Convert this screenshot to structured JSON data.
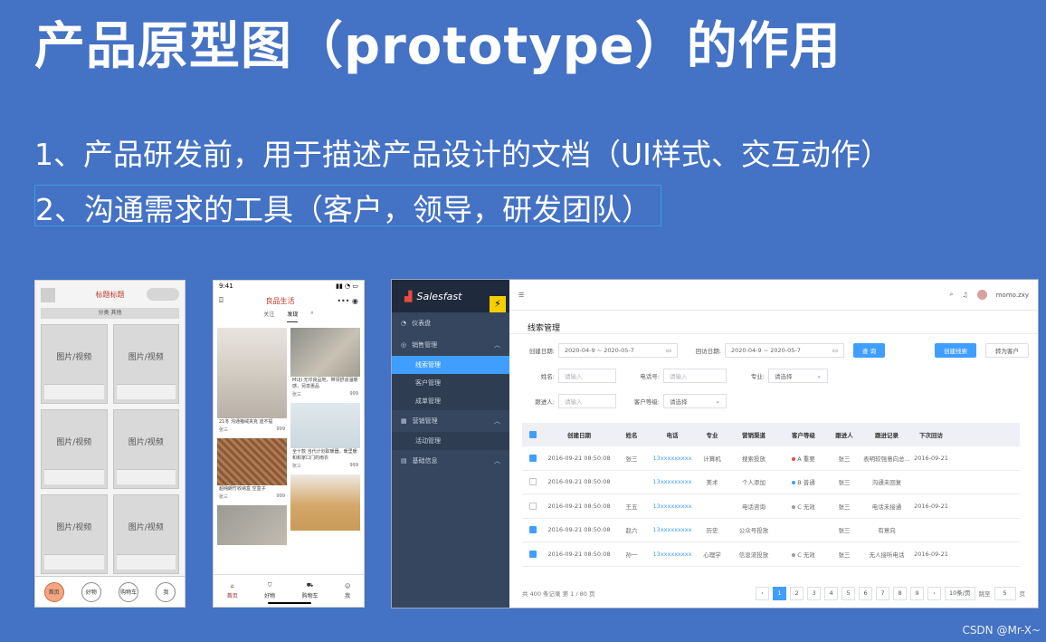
{
  "slide": {
    "title": "产品原型图（prototype）的作用",
    "bullets": [
      "1、产品研发前，用于描述产品设计的文档（UI样式、交互动作）",
      "2、沟通需求的工具（客户，领导，研发团队）"
    ],
    "watermark": "CSDN @Mr-X~"
  },
  "wireframe": {
    "title": "标题标题",
    "tabs": "分类 其他",
    "card_label": "图片/视频",
    "nav": [
      "首页",
      "好物",
      "购物车",
      "我"
    ]
  },
  "mobile": {
    "time": "9:41",
    "app_title": "良品生活",
    "tabs": [
      "关注",
      "发现"
    ],
    "captions": [
      "21冬 沟通猪绒夹克 迪不提",
      "MUJI 无印良品地，带领舒适温暖感，另享惠品",
      "全十款 当代计划取暖器，暖里暖和和家口门的雨衣",
      "超纯朗竹收纳盒 空盒子"
    ],
    "authors": [
      "张三",
      "张三",
      "张三",
      "张三"
    ],
    "likes": [
      "999",
      "999",
      "999",
      "999"
    ],
    "nav": [
      "首页",
      "好物",
      "购物车",
      "我"
    ]
  },
  "admin": {
    "brand": "Salesfast",
    "user": "momo.zxy",
    "menu": {
      "dashboard": "仪表盘",
      "sales": "销售管理",
      "sales_sub": [
        "线索管理",
        "客户管理",
        "成单管理"
      ],
      "marketing": "营销管理",
      "marketing_sub": [
        "活动管理"
      ],
      "basic": "基础信息"
    },
    "page_title": "线索管理",
    "filters": {
      "create_date_label": "创建日期:",
      "create_date_value": "2020-04-9 ~ 2020-05-7",
      "visit_date_label": "回访日期:",
      "visit_date_value": "2020-04-9 ~ 2020-05-7",
      "query_btn": "查 询",
      "create_btn": "创建线索",
      "convert_btn": "转为客户",
      "name_label": "姓名:",
      "name_ph": "请输入",
      "phone_label": "电话号:",
      "phone_ph": "请输入",
      "major_label": "专业:",
      "major_value": "请选择",
      "follower_label": "跟进人:",
      "follower_ph": "请输入",
      "level_label": "客户等级:",
      "level_value": "请选择"
    },
    "table": {
      "headers": [
        "创建日期",
        "姓名",
        "电话",
        "专业",
        "营销渠道",
        "客户等级",
        "跟进人",
        "跟进记录",
        "下次回访"
      ],
      "rows": [
        {
          "checked": true,
          "date": "2016-09-21  08:50:08",
          "name": "张三",
          "phone": "13xxxxxxxxx",
          "major": "计算机",
          "channel": "搜索投放",
          "level": "A 重要",
          "level_color": "#e74c3c",
          "follower": "张三",
          "record": "表明较强意向总...",
          "next": "2016-09-21"
        },
        {
          "checked": false,
          "date": "2016-09-21  08:50:08",
          "name": "",
          "phone": "13xxxxxxxxx",
          "major": "美术",
          "channel": "个人添加",
          "level": "B 普通",
          "level_color": "#409eff",
          "follower": "张三",
          "record": "沟通未回复",
          "next": ""
        },
        {
          "checked": false,
          "date": "2016-09-21  08:50:08",
          "name": "王五",
          "phone": "13xxxxxxxxx",
          "major": "",
          "channel": "电话咨询",
          "level": "C 无效",
          "level_color": "#999999",
          "follower": "张三",
          "record": "电话未接通",
          "next": "2016-09-21"
        },
        {
          "checked": true,
          "date": "2016-09-21  08:50:08",
          "name": "赵六",
          "phone": "13xxxxxxxxx",
          "major": "历史",
          "channel": "公众号投放",
          "level": "",
          "level_color": "#999999",
          "follower": "张三",
          "record": "有意向",
          "next": ""
        },
        {
          "checked": true,
          "date": "2016-09-21  08:50:08",
          "name": "孙一",
          "phone": "13xxxxxxxxx",
          "major": "心理学",
          "channel": "信息流投放",
          "level": "C 无效",
          "level_color": "#999999",
          "follower": "张三",
          "record": "无人接听电话",
          "next": "2016-09-21"
        }
      ]
    },
    "pager": {
      "summary": "共 400 条记录 第 1 / 80 页",
      "pages": [
        "1",
        "2",
        "3",
        "4",
        "5",
        "6",
        "7",
        "8",
        "9"
      ],
      "per_page": "10条/页",
      "jump_label": "跳至",
      "jump_value": "5",
      "page_unit": "页"
    }
  }
}
